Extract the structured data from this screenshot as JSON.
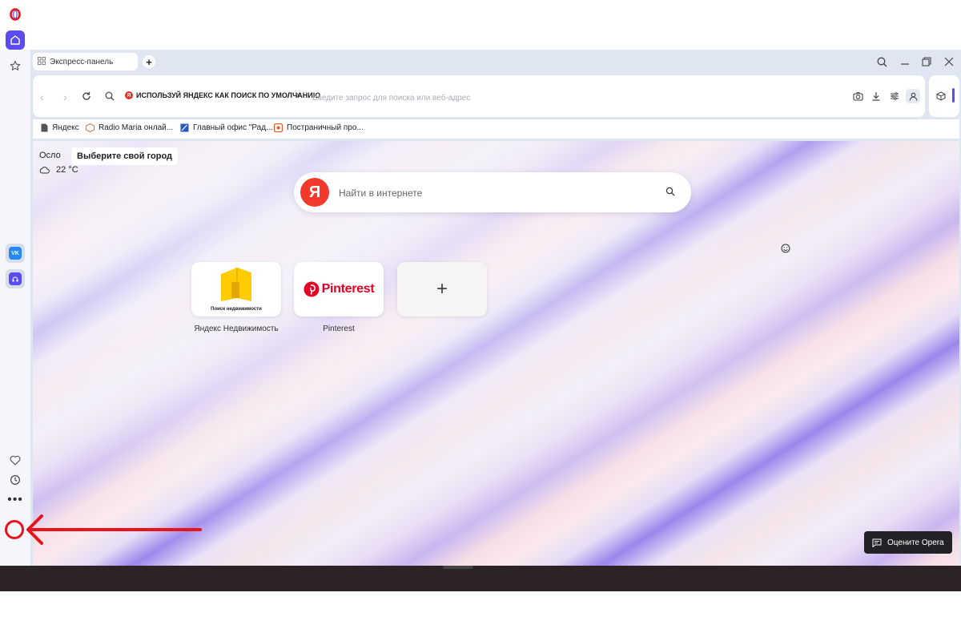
{
  "tabs": [
    {
      "label": "Экспресс-панель"
    }
  ],
  "toolbar": {
    "search_chip": "ИСПОЛЬЗУЙ ЯНДЕКС КАК ПОИСК ПО УМОЛЧАНИЮ",
    "chip_close": "×",
    "address_placeholder": "Введите запрос для поиска или веб-адрес"
  },
  "bookmarks": [
    {
      "label": "Яндекс"
    },
    {
      "label": "Radio Maria онлай..."
    },
    {
      "label": "Главный офис \"Рад..."
    },
    {
      "label": "Постраничный про..."
    }
  ],
  "weather": {
    "city": "Осло",
    "choose_city": "Выберите свой город",
    "temperature": "22 °C"
  },
  "search": {
    "logo_letter": "Я",
    "placeholder": "Найти в интернете"
  },
  "speed_dial": [
    {
      "label": "Яндекс Недвижимость",
      "tile_caption": "Поиск недвижимости"
    },
    {
      "label": "Pinterest",
      "tile_caption": "Pinterest"
    },
    {
      "label": "",
      "tile_caption": "+"
    }
  ],
  "rate_button": "Оцените Opera",
  "sidebar": {
    "vk": "VK",
    "more": "•••"
  },
  "colors": {
    "accent": "#5b4cf0",
    "annotation": "#e8141c",
    "yandex_red": "#f2392b",
    "pinterest_red": "#e60023"
  }
}
